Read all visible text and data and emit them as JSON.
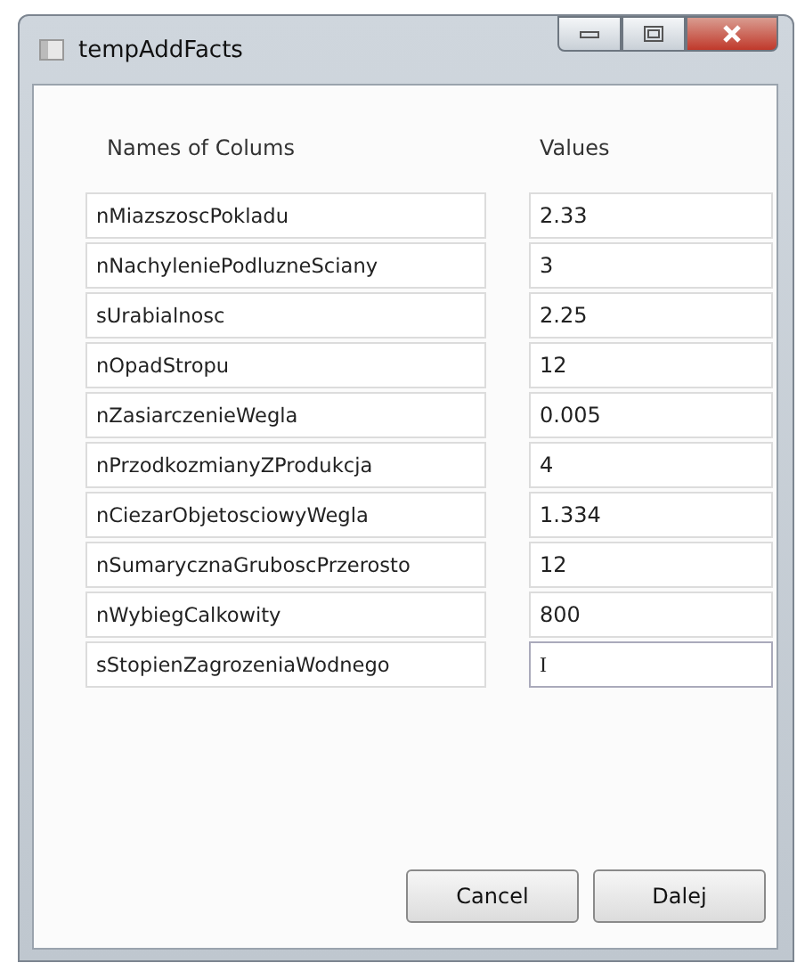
{
  "window": {
    "title": "tempAddFacts"
  },
  "headers": {
    "names": "Names of Colums",
    "values": "Values"
  },
  "rows": [
    {
      "name": "nMiazszoscPokladu",
      "value": "2.33"
    },
    {
      "name": "nNachyleniePodluzneSciany",
      "value": "3"
    },
    {
      "name": "sUrabialnosc",
      "value": "2.25"
    },
    {
      "name": "nOpadStropu",
      "value": "12"
    },
    {
      "name": "nZasiarczenieWegla",
      "value": "0.005"
    },
    {
      "name": "nPrzodkozmianyZProdukcja",
      "value": "4"
    },
    {
      "name": "nCiezarObjetosciowyWegla",
      "value": "1.334"
    },
    {
      "name": "nSumarycznaGruboscPrzerosto",
      "value": "12"
    },
    {
      "name": "nWybiegCalkowity",
      "value": "800"
    },
    {
      "name": "sStopienZagrozeniaWodnego",
      "value": "I"
    }
  ],
  "buttons": [
    "Cancel",
    "Dalej"
  ]
}
